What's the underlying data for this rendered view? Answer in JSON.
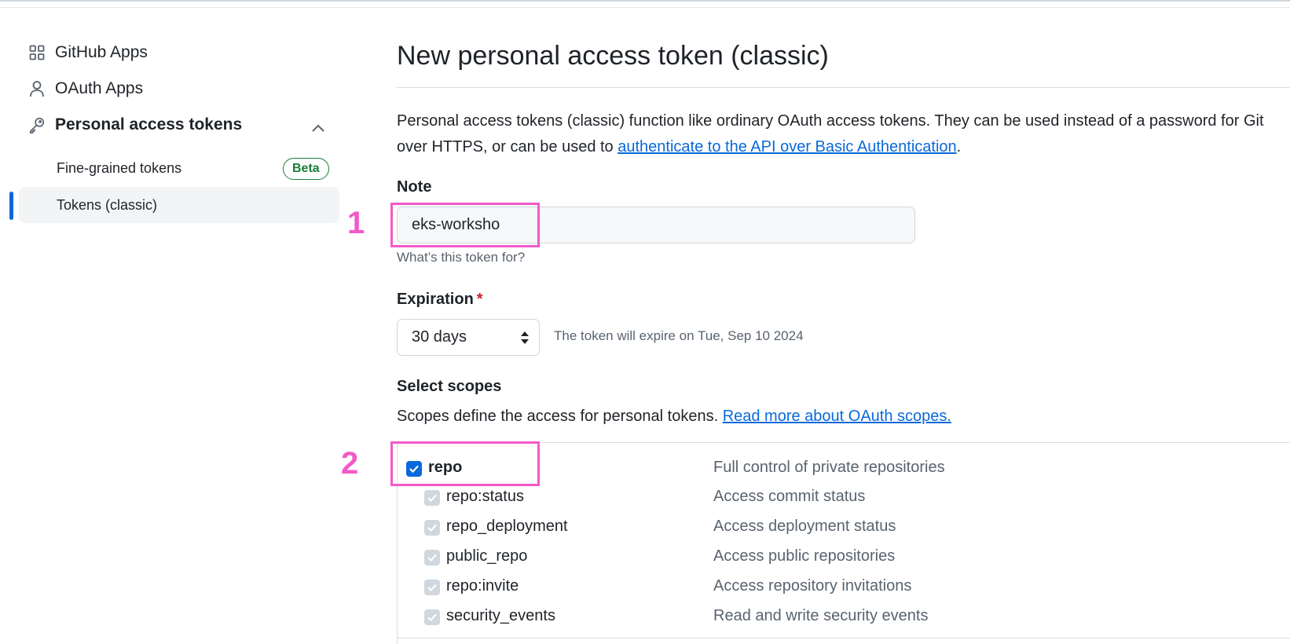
{
  "sidebar": {
    "items": [
      {
        "label": "GitHub Apps",
        "icon": "apps-grid-icon"
      },
      {
        "label": "OAuth Apps",
        "icon": "person-icon"
      },
      {
        "label": "Personal access tokens",
        "icon": "key-icon"
      }
    ],
    "sub_items": [
      {
        "label": "Fine-grained tokens",
        "badge": "Beta"
      },
      {
        "label": "Tokens (classic)",
        "active": true
      }
    ]
  },
  "main": {
    "title": "New personal access token (classic)",
    "intro_text": "Personal access tokens (classic) function like ordinary OAuth access tokens. They can be used instead of a password for Git over HTTPS, or can be used to ",
    "intro_link": "authenticate to the API over Basic Authentication",
    "intro_end": ".",
    "note": {
      "label": "Note",
      "value": "eks-worksho",
      "hint": "What’s this token for?"
    },
    "expiration": {
      "label": "Expiration",
      "required_mark": "*",
      "selected": "30 days",
      "text": "The token will expire on Tue, Sep 10 2024"
    },
    "scopes": {
      "label": "Select scopes",
      "description": "Scopes define the access for personal tokens. ",
      "link": "Read more about OAuth scopes.",
      "rows": [
        {
          "name": "repo",
          "desc": "Full control of private repositories",
          "checked": true,
          "parent": true
        },
        {
          "name": "repo:status",
          "desc": "Access commit status",
          "checked": true,
          "parent": false
        },
        {
          "name": "repo_deployment",
          "desc": "Access deployment status",
          "checked": true,
          "parent": false
        },
        {
          "name": "public_repo",
          "desc": "Access public repositories",
          "checked": true,
          "parent": false
        },
        {
          "name": "repo:invite",
          "desc": "Access repository invitations",
          "checked": true,
          "parent": false
        },
        {
          "name": "security_events",
          "desc": "Read and write security events",
          "checked": true,
          "parent": false
        }
      ]
    }
  },
  "annotations": {
    "step1": "1",
    "step2": "2",
    "color": "#f25ac8"
  },
  "colors": {
    "accent": "#0969da",
    "beta_green": "#1a7f37",
    "required_red": "#cf222e"
  }
}
